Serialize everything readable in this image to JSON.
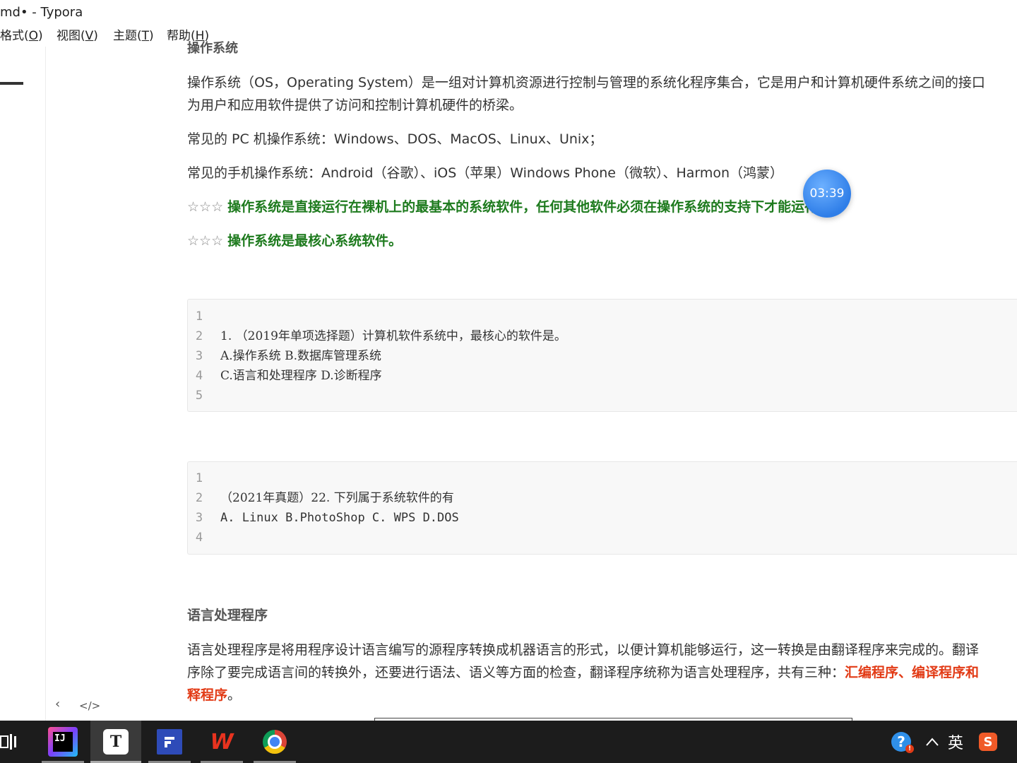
{
  "window": {
    "title": "md• - Typora"
  },
  "menu": [
    {
      "label": "格式(",
      "key": "O",
      "end": ")"
    },
    {
      "label": "视图(",
      "key": "V",
      "end": ")"
    },
    {
      "label": "主题(",
      "key": "T",
      "end": ")"
    },
    {
      "label": "帮助(",
      "key": "H",
      "end": ")"
    }
  ],
  "doc": {
    "cut_heading": "操作系统",
    "para1_line1": "操作系统（OS，Operating System）是一组对计算机资源进行控制与管理的系统化程序集合，它是用户和计算机硬件系统之间的接口",
    "para1_line2": "为用户和应用软件提供了访问和控制计算机硬件的桥梁。",
    "para2": "常见的 PC 机操作系统：Windows、DOS、MacOS、Linux、Unix；",
    "para3": "常见的手机操作系统：Android（谷歌）、iOS（苹果）Windows Phone（微软）、Harmon（鸿蒙）",
    "star1_stars": "☆☆☆",
    "star1_text": "操作系统是直接运行在裸机上的最基本的系统软件，任何其他软件必须在操作系统的支持下才能运行。",
    "star2_stars": "☆☆☆",
    "star2_text": "操作系统是最核心系统软件。",
    "code1": [
      {
        "n": "1",
        "t": ""
      },
      {
        "n": "2",
        "t": "1. （2019年单项选择题）计算机软件系统中，最核心的软件是。"
      },
      {
        "n": "3",
        "t": "A.操作系统 B.数据库管理系统"
      },
      {
        "n": "4",
        "t": "C.语言和处理程序 D.诊断程序"
      },
      {
        "n": "5",
        "t": ""
      }
    ],
    "code2": [
      {
        "n": "1",
        "t": ""
      },
      {
        "n": "2",
        "t": "（2021年真题）22. 下列属于系统软件的有"
      },
      {
        "n": "3",
        "t": "A. Linux B.PhotoShop C. WPS D.DOS"
      },
      {
        "n": "4",
        "t": ""
      }
    ],
    "heading2": "语言处理程序",
    "para4_line1": "语言处理程序是将用程序设计语言编写的源程序转换成机器语言的形式，以便计算机能够运行，这一转换是由翻译程序来完成的。翻译",
    "para4_line2_a": "序除了要完成语言间的转换外，还要进行语法、语义等方面的检查，翻译程序统称为语言处理程序，共有三种：",
    "para4_line2_red": "汇编程序、编译程序和",
    "para4_line3_red": "释程序",
    "para4_line3_end": "。"
  },
  "timer": {
    "value": "03:39"
  },
  "sidebar": {
    "back_icon": "‹",
    "source_icon": "</>"
  },
  "taskbar": {
    "ime_label": "英",
    "apps": [
      "IntelliJ IDEA",
      "Typora",
      "Flomo",
      "WPS",
      "Chrome"
    ]
  },
  "colors": {
    "accent_green": "#1d7a1d",
    "accent_red": "#e23b16",
    "timer_blue": "#2f7ee8"
  }
}
